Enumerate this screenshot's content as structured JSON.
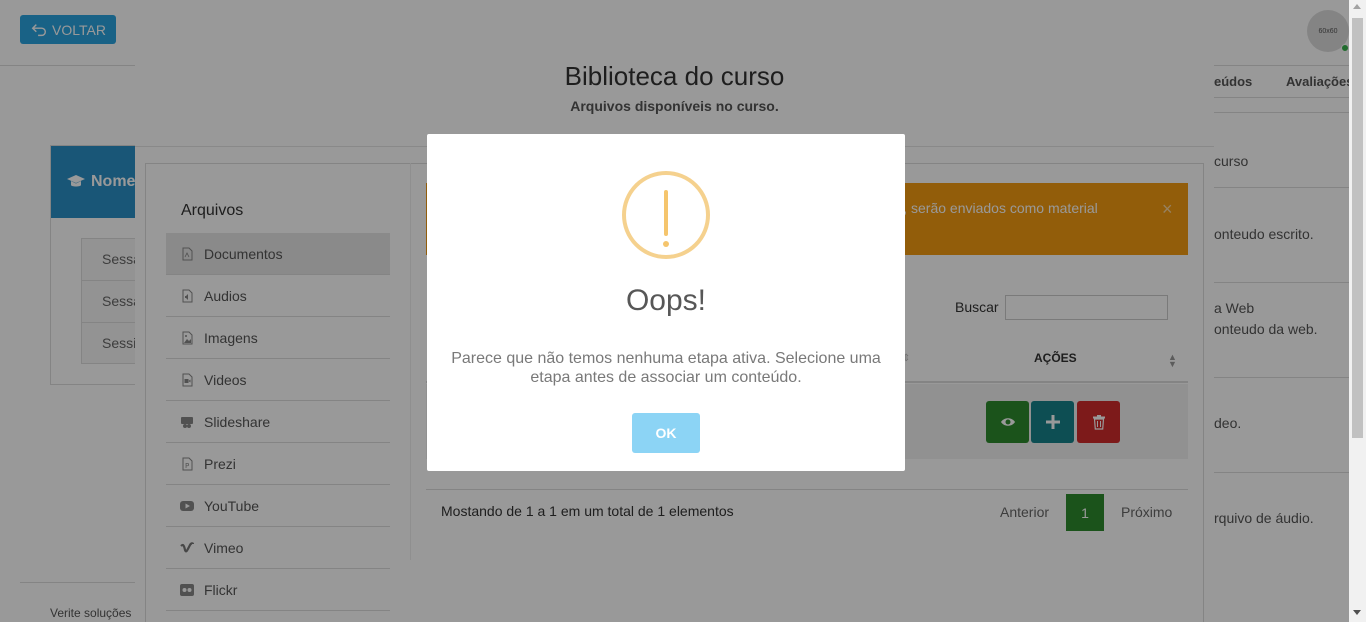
{
  "topbar": {
    "back_label": "VOLTAR",
    "avatar_text": "60x60"
  },
  "tabs": {
    "contents_label": "eúdos",
    "evaluations_label": "Avaliações"
  },
  "right_list": {
    "items": [
      {
        "line1": "curso",
        "line2": ""
      },
      {
        "line1": "onteudo escrito.",
        "line2": ""
      },
      {
        "line1": "a Web",
        "line2": "onteudo da web."
      },
      {
        "line1": "deo.",
        "line2": ""
      },
      {
        "line1": "rquivo de áudio.",
        "line2": ""
      }
    ]
  },
  "course_card": {
    "title": "Nome",
    "sessions": [
      "Sessa",
      "Sessa",
      "Sessi"
    ]
  },
  "footer": {
    "text": "Verite soluções"
  },
  "library": {
    "title": "Biblioteca do curso",
    "subtitle": "Arquivos disponíveis no curso.",
    "sidebar_heading": "Arquivos",
    "menu": [
      {
        "label": "Documentos",
        "icon": "document-icon",
        "active": true
      },
      {
        "label": "Audios",
        "icon": "audio-file-icon",
        "active": false
      },
      {
        "label": "Imagens",
        "icon": "image-file-icon",
        "active": false
      },
      {
        "label": "Videos",
        "icon": "video-file-icon",
        "active": false
      },
      {
        "label": "Slideshare",
        "icon": "slideshare-icon",
        "active": false
      },
      {
        "label": "Prezi",
        "icon": "prezi-icon",
        "active": false
      },
      {
        "label": "YouTube",
        "icon": "youtube-icon",
        "active": false
      },
      {
        "label": "Vimeo",
        "icon": "vimeo-icon",
        "active": false
      },
      {
        "label": "Flickr",
        "icon": "flickr-icon",
        "active": false
      }
    ],
    "alert_text": "ares, serão enviados como material",
    "alert_close": "×",
    "search_label": "Buscar",
    "search_value": "",
    "table": {
      "actions_header": "AÇÕES"
    },
    "pagination": {
      "info": "Mostando de 1 a 1 em um total de 1 elementos",
      "prev": "Anterior",
      "current": "1",
      "next": "Próximo"
    }
  },
  "dialog": {
    "title": "Oops!",
    "message": "Parece que não temos nenhuma etapa ativa. Selecione uma etapa antes de associar um conteúdo.",
    "ok_label": "OK"
  },
  "colors": {
    "primary": "#2aa3e0",
    "warning": "#f39c12",
    "success": "#2e8b2e",
    "info": "#17838a",
    "danger": "#d12c2c",
    "ok_button": "#8cd4f5",
    "warning_icon": "#f5c56d"
  }
}
